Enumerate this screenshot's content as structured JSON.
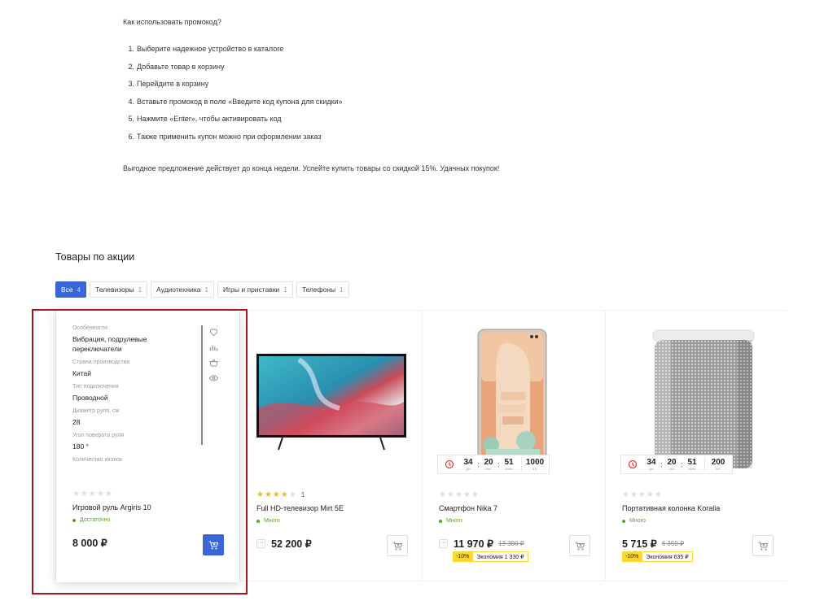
{
  "howto": {
    "title": "Как использовать промокод?",
    "steps": [
      {
        "num": "1.",
        "text": "Выберите надежное устройство в каталоге"
      },
      {
        "num": "2.",
        "text": "Добавьте товар в корзину"
      },
      {
        "num": "3.",
        "text": "Перейдите в корзину"
      },
      {
        "num": "4.",
        "text": "Вставьте промокод в поле «Введите код купона для скидки»"
      },
      {
        "num": "5.",
        "text": "Нажмите «Enter», чтобы активировать код"
      },
      {
        "num": "6.",
        "text": "Также применить купон можно при оформлении заказ"
      }
    ],
    "note": "Выгодное предложение действует до конца недели. Успейте купить товары со скидкой 15%. Удачных покупок!"
  },
  "section": {
    "title": "Товары по акции"
  },
  "tabs": [
    {
      "label": "Все",
      "count": "4",
      "active": true
    },
    {
      "label": "Телевизоры",
      "count": "1"
    },
    {
      "label": "Аудиотехника",
      "count": "1"
    },
    {
      "label": "Игры и приставки",
      "count": "1"
    },
    {
      "label": "Телефоны",
      "count": "1"
    }
  ],
  "products": [
    {
      "specs": [
        {
          "label": "Особенности",
          "value": "Вибрация, подрулевые переключатели"
        },
        {
          "label": "Страна производства",
          "value": "Китай"
        },
        {
          "label": "Тип подключения",
          "value": "Проводной"
        },
        {
          "label": "Диаметр руля, см",
          "value": "28"
        },
        {
          "label": "Угол поворота руля",
          "value": "180 °"
        },
        {
          "label": "Количество кнопок",
          "value": ""
        }
      ],
      "rating": 0,
      "name": "Игровой руль Argiris 10",
      "stock": "Достаточно",
      "price": "8 000 ₽"
    },
    {
      "rating": 4,
      "votes": "1",
      "name": "Full HD-телевизор Mirt 5E",
      "stock": "Много",
      "more": "···",
      "price": "52 200 ₽"
    },
    {
      "timer": {
        "days": "34",
        "hours": "20",
        "minutes": "51",
        "qty": "1000",
        "days_label": "ДН",
        "hours_label": "ЧАС",
        "minutes_label": "МИН",
        "qty_label": "ШТ"
      },
      "rating": 0,
      "name": "Смартфон Nika 7",
      "stock": "Много",
      "more": "···",
      "price": "11 970 ₽",
      "old_price": "13 300 ₽",
      "discount_pct": "-10%",
      "economy": "Экономия 1 330 ₽"
    },
    {
      "timer": {
        "days": "34",
        "hours": "20",
        "minutes": "51",
        "qty": "200",
        "days_label": "ДН",
        "hours_label": "ЧАС",
        "minutes_label": "МИН",
        "qty_label": "ШТ"
      },
      "rating": 0,
      "name": "Портативная колонка Koralia",
      "stock": "Много",
      "price": "5 715 ₽",
      "old_price": "6 350 ₽",
      "discount_pct": "-10%",
      "economy": "Экономия 635 ₽"
    }
  ],
  "colors": {
    "accent": "#3a66d8",
    "in_stock": "#5aa02c",
    "star": "#f0b429",
    "discount": "#fdd835",
    "highlight": "#a3181c"
  }
}
